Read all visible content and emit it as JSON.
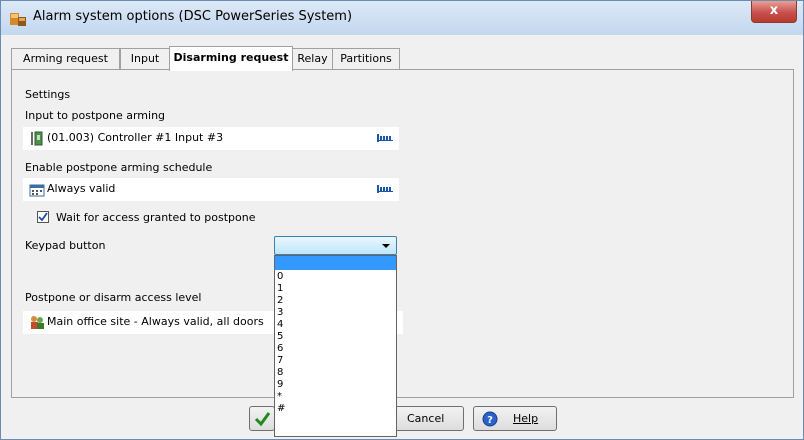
{
  "window": {
    "title": "Alarm system options (DSC PowerSeries System)",
    "close_label": "x"
  },
  "tabs": [
    {
      "label": "Arming request",
      "active": false
    },
    {
      "label": "Input",
      "active": false
    },
    {
      "label": "Disarming request",
      "active": true
    },
    {
      "label": "Relay",
      "active": false
    },
    {
      "label": "Partitions",
      "active": false
    }
  ],
  "settings": {
    "section_label": "Settings",
    "postpone_input": {
      "label": "Input to postpone arming",
      "value": "(01.003) Controller #1 Input #3",
      "icon": "input-device-icon"
    },
    "postpone_schedule": {
      "label": "Enable postpone arming schedule",
      "value": "Always valid",
      "icon": "calendar-icon"
    },
    "wait_access": {
      "label": "Wait for access granted to postpone",
      "checked": true
    },
    "keypad": {
      "label": "Keypad button",
      "value": "",
      "options": [
        "",
        "0",
        "1",
        "2",
        "3",
        "4",
        "5",
        "6",
        "7",
        "8",
        "9",
        "*",
        "#"
      ],
      "open": true
    }
  },
  "access_level": {
    "label": "Postpone or disarm access level",
    "value": "Main office site - Always valid, all doors",
    "icon": "access-level-icon"
  },
  "buttons": {
    "ok_icon": "checkmark-icon",
    "cancel_label": "Cancel",
    "help_label": "Help",
    "help_icon": "help-icon"
  },
  "colors": {
    "accent": "#3399ff",
    "close": "#c75050",
    "title_gradient": "#c3d7ef"
  }
}
